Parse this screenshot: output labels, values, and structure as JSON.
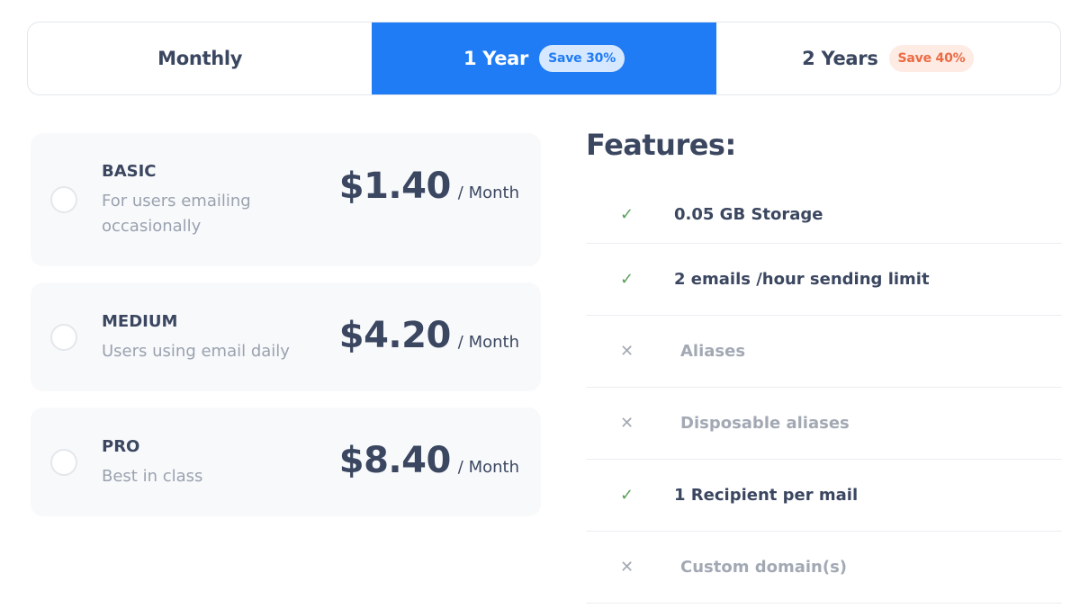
{
  "billing_tabs": [
    {
      "label": "Monthly",
      "badge": ""
    },
    {
      "label": "1 Year",
      "badge": "Save 30%",
      "active": true
    },
    {
      "label": "2 Years",
      "badge": "Save 40%"
    }
  ],
  "plans": [
    {
      "name": "BASIC",
      "description": "For users emailing occasionally",
      "price": "$1.40",
      "period": "/ Month",
      "selected": false
    },
    {
      "name": "MEDIUM",
      "description": "Users using email daily",
      "price": "$4.20",
      "period": "/ Month",
      "selected": false
    },
    {
      "name": "PRO",
      "description": "Best in class",
      "price": "$8.40",
      "period": "/ Month",
      "selected": false
    }
  ],
  "features": {
    "title": "Features:",
    "items": [
      {
        "label": "0.05  GB Storage",
        "included": true,
        "icon": "check-icon",
        "symbol": "✓"
      },
      {
        "label": "2 emails /hour sending limit",
        "included": true,
        "icon": "check-icon",
        "symbol": "✓"
      },
      {
        "label": "Aliases",
        "included": false,
        "icon": "x-icon",
        "symbol": "✕"
      },
      {
        "label": "Disposable aliases",
        "included": false,
        "icon": "x-icon",
        "symbol": "✕"
      },
      {
        "label": "1  Recipient per mail",
        "included": true,
        "icon": "check-icon",
        "symbol": "✓"
      },
      {
        "label": "Custom domain(s)",
        "included": false,
        "icon": "x-icon",
        "symbol": "✕"
      }
    ]
  },
  "colors": {
    "accent": "#1f7cf5",
    "text": "#3b4760",
    "muted": "#9aa2af",
    "check": "#5aa05a",
    "save_blue_bg": "#d6e8ff",
    "save_orange_text": "#ec6b43"
  }
}
